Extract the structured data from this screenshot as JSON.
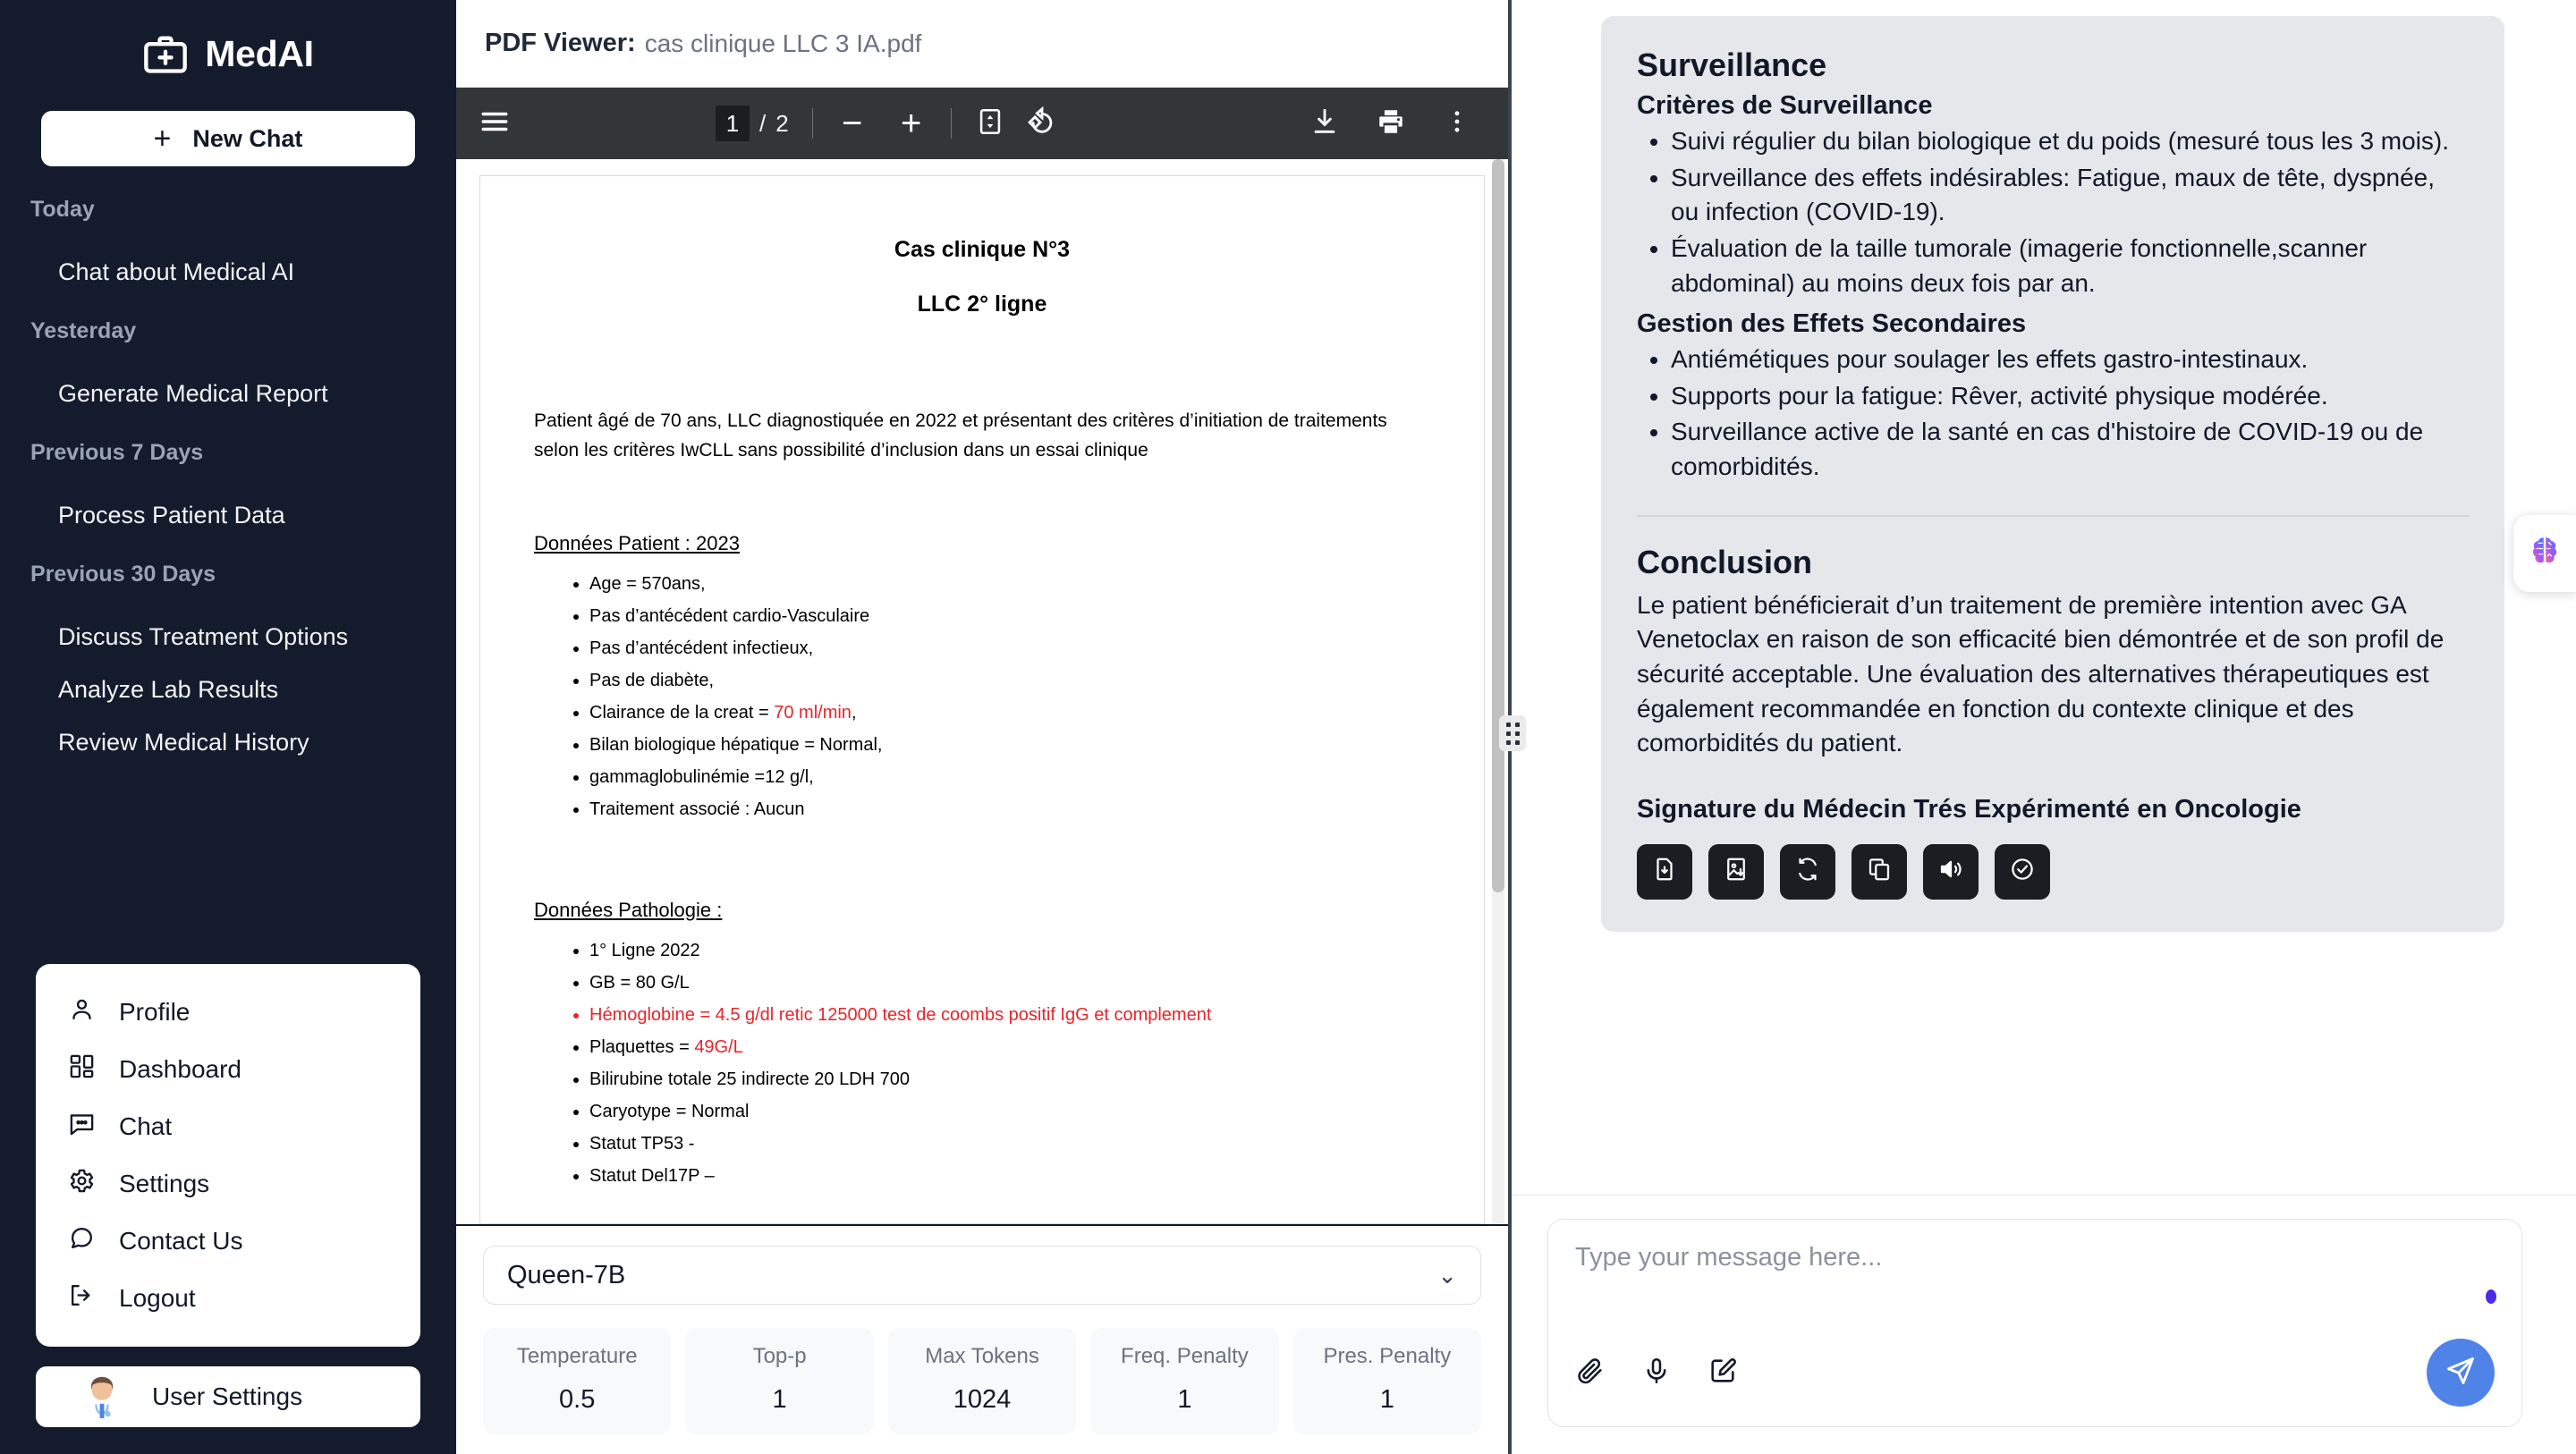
{
  "app": {
    "brand_name": "MedAI"
  },
  "sidebar": {
    "new_chat_label": "New Chat",
    "groups": [
      {
        "label": "Today",
        "items": [
          "Chat about Medical AI"
        ]
      },
      {
        "label": "Yesterday",
        "items": [
          "Generate Medical Report"
        ]
      },
      {
        "label": "Previous 7 Days",
        "items": [
          "Process Patient Data"
        ]
      },
      {
        "label": "Previous 30 Days",
        "items": [
          "Discuss Treatment Options",
          "Analyze Lab Results",
          "Review Medical History"
        ]
      }
    ],
    "menu": [
      {
        "label": "Profile",
        "icon": "user-icon"
      },
      {
        "label": "Dashboard",
        "icon": "dashboard-icon"
      },
      {
        "label": "Chat",
        "icon": "chat-bubble-icon"
      },
      {
        "label": "Settings",
        "icon": "gear-icon"
      },
      {
        "label": "Contact Us",
        "icon": "speech-bubble-icon"
      },
      {
        "label": "Logout",
        "icon": "logout-icon"
      }
    ],
    "user_label": "User Settings"
  },
  "pdf": {
    "header_title": "PDF Viewer:",
    "file_name": "cas clinique LLC 3 IA.pdf",
    "toolbar": {
      "current_page": "1",
      "separator": "/",
      "total_pages": "2",
      "zoom_out": "−",
      "zoom_in": "+"
    },
    "doc": {
      "title": "Cas clinique N°3",
      "subtitle": "LLC 2° ligne",
      "intro": "Patient âgé de 70 ans,  LLC diagnostiquée en 2022 et présentant des critères d’initiation de traitements selon les critères IwCLL sans possibilité d’inclusion dans un essai clinique",
      "patient_heading": "Données Patient : 2023",
      "patient_items": [
        "Age = 570ans,",
        "Pas d’antécédent cardio-Vasculaire",
        "Pas d’antécédent infectieux,",
        "Pas de diabète,",
        "Clairance de la creat = 70 ml/min,",
        "Bilan biologique hépatique = Normal,",
        "gammaglobulinémie  =12 g/l,",
        "Traitement associé : Aucun"
      ],
      "patient_creat_prefix": "Clairance de la creat = ",
      "patient_creat_value": "70 ml/min",
      "patient_creat_suffix": ",",
      "patho_heading": "Données Pathologie :",
      "patho_items": [
        "1° Ligne 2022",
        "GB = 80 G/L",
        "Hémoglobine = 4.5 g/dl  retic 125000  test de coombs positif IgG et complement",
        "Plaquettes = 49G/L",
        "Bilirubine totale 25  indirecte  20  LDH 700",
        "Caryotype = Normal",
        "Statut TP53 -",
        "Statut Del17P –"
      ],
      "patho_plaq_prefix": "Plaquettes = ",
      "patho_plaq_value": "49G/L"
    }
  },
  "params": {
    "model": "Queen-7B",
    "items": [
      {
        "label": "Temperature",
        "value": "0.5"
      },
      {
        "label": "Top-p",
        "value": "1"
      },
      {
        "label": "Max Tokens",
        "value": "1024"
      },
      {
        "label": "Freq. Penalty",
        "value": "1"
      },
      {
        "label": "Pres. Penalty",
        "value": "1"
      }
    ]
  },
  "assistant": {
    "h_surveillance": "Surveillance",
    "h_criteres": "Critères de Surveillance",
    "criteres_items": [
      "Suivi régulier du bilan biologique et du poids (mesuré tous les 3 mois).",
      "Surveillance des effets indésirables: Fatigue, maux de tête, dyspnée, ou infection (COVID-19).",
      "Évaluation de la taille tumorale (imagerie fonctionnelle,scanner abdominal) au moins deux fois par an."
    ],
    "h_gestion": "Gestion des Effets Secondaires",
    "gestion_items": [
      "Antiémétiques pour soulager les effets gastro-intestinaux.",
      "Supports pour la fatigue: Rêver, activité physique modérée.",
      "Surveillance active de la santé en cas d'histoire de COVID-19 ou de comorbidités."
    ],
    "h_conclusion": "Conclusion",
    "conclusion_text": "Le patient bénéficierait d’un traitement de première intention avec GA Venetoclax en raison de son efficacité bien démontrée et de son profil de sécurité acceptable. Une évaluation des alternatives thérapeutiques est également recommandée en fonction du contexte clinique et des comorbidités du patient.",
    "signature": "Signature du Médecin Trés Expérimenté en Oncologie",
    "actions": [
      "download-file-icon",
      "download-image-icon",
      "regenerate-icon",
      "copy-icon",
      "speaker-icon",
      "approve-check-icon"
    ]
  },
  "composer": {
    "placeholder": "Type your message here...",
    "tools": [
      "attach-icon",
      "microphone-icon",
      "edit-icon"
    ],
    "send": "send-icon"
  },
  "colors": {
    "sidebar_bg": "#141b2d",
    "toolbar_bg": "#323639",
    "accent_blue": "#4f83e8",
    "assistant_card_bg": "#e5e7eb",
    "alert_red": "#e8242a",
    "dot_purple": "#4b2ae8"
  }
}
